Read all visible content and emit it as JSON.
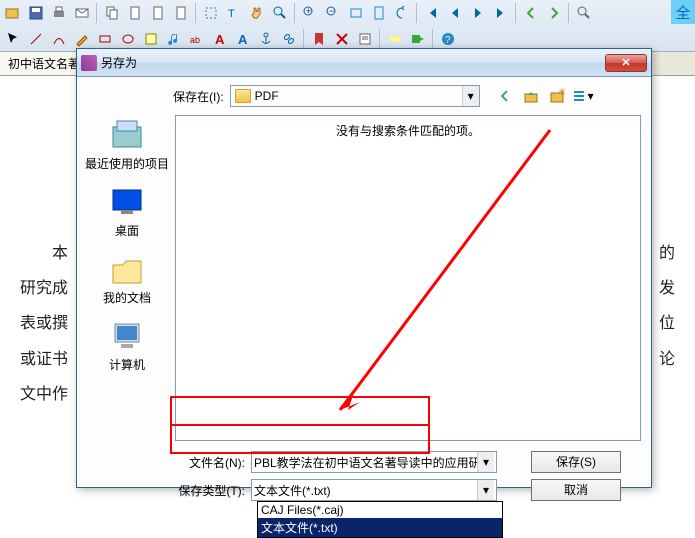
{
  "toolbar": {
    "fullscreen_label": "全"
  },
  "tab": {
    "title": "初中语文名著"
  },
  "document": {
    "line1": "本",
    "line2": "研究成",
    "line3": "表或撰",
    "line4": "或证书",
    "line5": "文中作",
    "r1": "的",
    "r2": "发",
    "r3": "位",
    "r4": "论"
  },
  "dialog": {
    "title": "另存为",
    "savein_label": "保存在(I):",
    "savein_value": "PDF",
    "no_match": "没有与搜索条件匹配的项。",
    "places": {
      "recent": "最近使用的项目",
      "desktop": "桌面",
      "mydocs": "我的文档",
      "computer": "计算机"
    },
    "filename_label": "文件名(N):",
    "filename_value": "PBL教学法在初中语文名著导读中的应用研",
    "filetype_label": "保存类型(T):",
    "filetype_value": "文本文件(*.txt)",
    "save_btn": "保存(S)",
    "cancel_btn": "取消",
    "dropdown": {
      "opt1": "CAJ Files(*.caj)",
      "opt2": "文本文件(*.txt)"
    }
  }
}
